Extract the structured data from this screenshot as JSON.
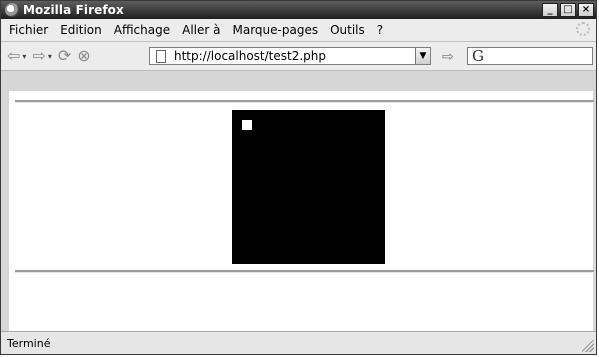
{
  "window": {
    "title": "Mozilla Firefox",
    "controls": [
      "_",
      "□",
      "×"
    ]
  },
  "menu": {
    "items": [
      "Fichier",
      "Edition",
      "Affichage",
      "Aller à",
      "Marque-pages",
      "Outils",
      "?"
    ]
  },
  "navigation": {
    "url": "http://localhost/test2.php",
    "search_engine": "G"
  },
  "content": {
    "square_color": "#000000",
    "dot_color": "#ffffff"
  },
  "status": {
    "text": "Terminé"
  }
}
